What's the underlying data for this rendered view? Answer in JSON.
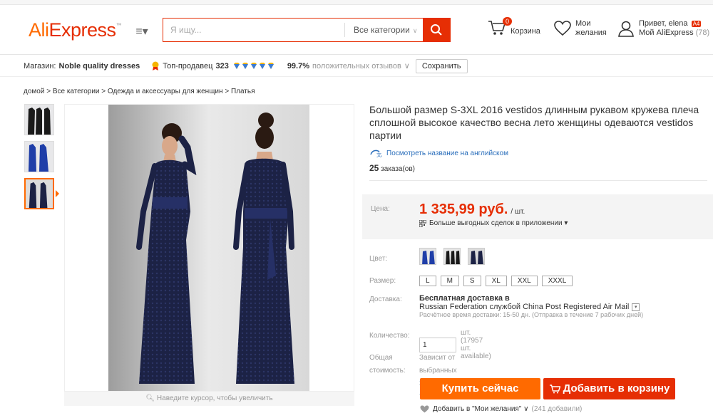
{
  "header": {
    "logo_ali": "Ali",
    "logo_express": "Express",
    "logo_tm": "™",
    "menu_icon": "menu-icon",
    "search_placeholder": "Я ищу...",
    "search_category": "Все категории",
    "cart_count": "0",
    "cart_label": "Корзина",
    "wish_label_1": "Мои",
    "wish_label_2": "желания",
    "greeting": "Привет, elena",
    "greeting_badge": "A4",
    "my_ali": "Мой AliExpress",
    "my_ali_count": "(78)"
  },
  "store": {
    "label": "Магазин:",
    "name": "Noble quality dresses",
    "topseller": "Топ-продавец",
    "score": "323",
    "feedback_pct": "99.7%",
    "feedback_text": "положительных отзывов",
    "save": "Сохранить"
  },
  "breadcrumb": "домой > Все категории > Одежда и аксессуары для женщин > Платья",
  "gallery": {
    "zoom_hint": "Наведите курсор, чтобы увеличить"
  },
  "product": {
    "title": "Большой размер S-3XL 2016 vestidos длинным рукавом кружева плеча сплошной высокое качество весна лето женщины одеваются vestidos партии",
    "translate": "Посмотреть название на английском",
    "orders_count": "25",
    "orders_label": "заказа(ов)",
    "price_label": "Цена:",
    "price": "1 335,99 руб.",
    "price_unit": "/ шт.",
    "app_deals": "Больше выгодных сделок в приложении",
    "color_label": "Цвет:",
    "size_label": "Размер:",
    "sizes": [
      "L",
      "M",
      "S",
      "XL",
      "XXL",
      "XXXL"
    ],
    "shipping_label": "Доставка:",
    "shipping_free": "Бесплатная доставка в",
    "shipping_via": "Russian Federation службой China Post Registered Air Mail",
    "shipping_est": "Расчётное время доставки: 15-50 дн. (Отправка в течение 7 рабочих дней)",
    "qty_label": "Количество:",
    "qty_value": "1",
    "qty_avail": "шт. (17957 шт. available)",
    "total_label_1": "Общая",
    "total_label_2": "стоимость:",
    "total_value": "Зависит от выбранных характеристик товара",
    "buy_now": "Купить сейчас",
    "add_cart": "Добавить в корзину",
    "wish_add": "Добавить в \"Мои желания\"",
    "wish_count": "(241 добавили)"
  },
  "colors": {
    "accent": "#ff6a00",
    "brand_red": "#e62e04",
    "link": "#2a6ebb",
    "dress": "#1c2245"
  }
}
